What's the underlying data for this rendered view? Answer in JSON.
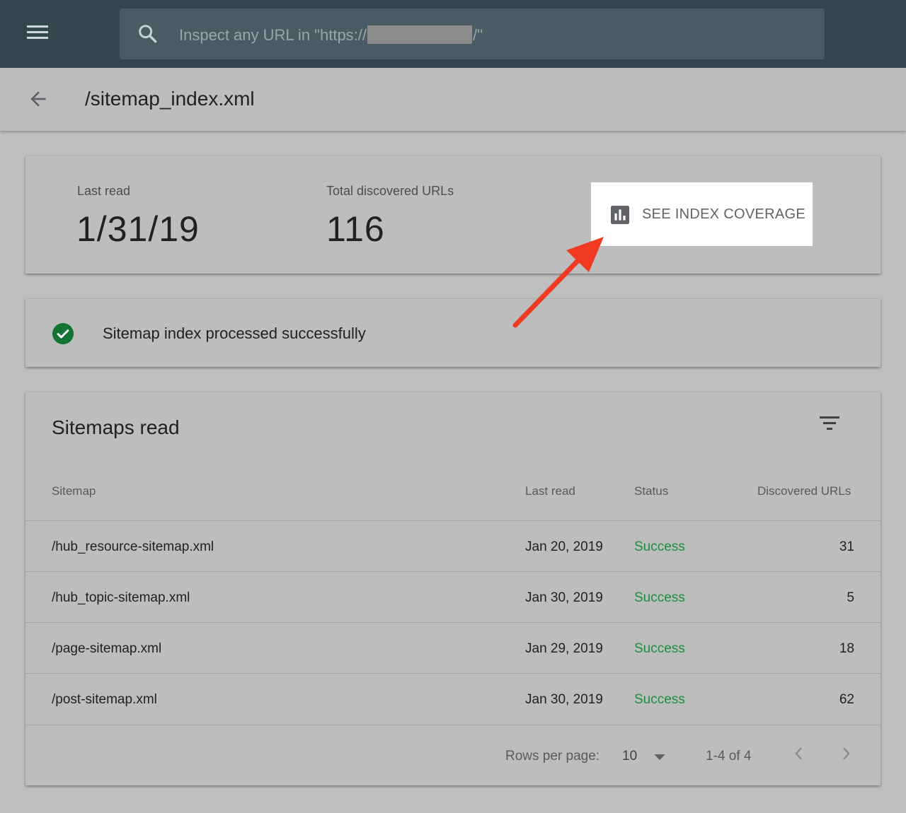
{
  "search": {
    "placeholder_before": "Inspect any URL in \"https://",
    "placeholder_after": "/\""
  },
  "header": {
    "title": "/sitemap_index.xml"
  },
  "summary": {
    "last_read_label": "Last read",
    "last_read_value": "1/31/19",
    "total_label": "Total discovered URLs",
    "total_value": "116",
    "coverage_button": "SEE INDEX COVERAGE"
  },
  "status_card": {
    "message": "Sitemap index processed successfully"
  },
  "table": {
    "title": "Sitemaps read",
    "columns": [
      "Sitemap",
      "Last read",
      "Status",
      "Discovered URLs"
    ],
    "rows": [
      {
        "sitemap": "/hub_resource-sitemap.xml",
        "last_read": "Jan 20, 2019",
        "status": "Success",
        "urls": "31"
      },
      {
        "sitemap": "/hub_topic-sitemap.xml",
        "last_read": "Jan 30, 2019",
        "status": "Success",
        "urls": "5"
      },
      {
        "sitemap": "/page-sitemap.xml",
        "last_read": "Jan 29, 2019",
        "status": "Success",
        "urls": "18"
      },
      {
        "sitemap": "/post-sitemap.xml",
        "last_read": "Jan 30, 2019",
        "status": "Success",
        "urls": "62"
      }
    ],
    "rows_per_page_label": "Rows per page:",
    "rows_per_page_value": "10",
    "range": "1-4 of 4"
  },
  "colors": {
    "topbar": "#34464d",
    "success": "#1e8e3e",
    "annotation_arrow": "#f03a22"
  }
}
